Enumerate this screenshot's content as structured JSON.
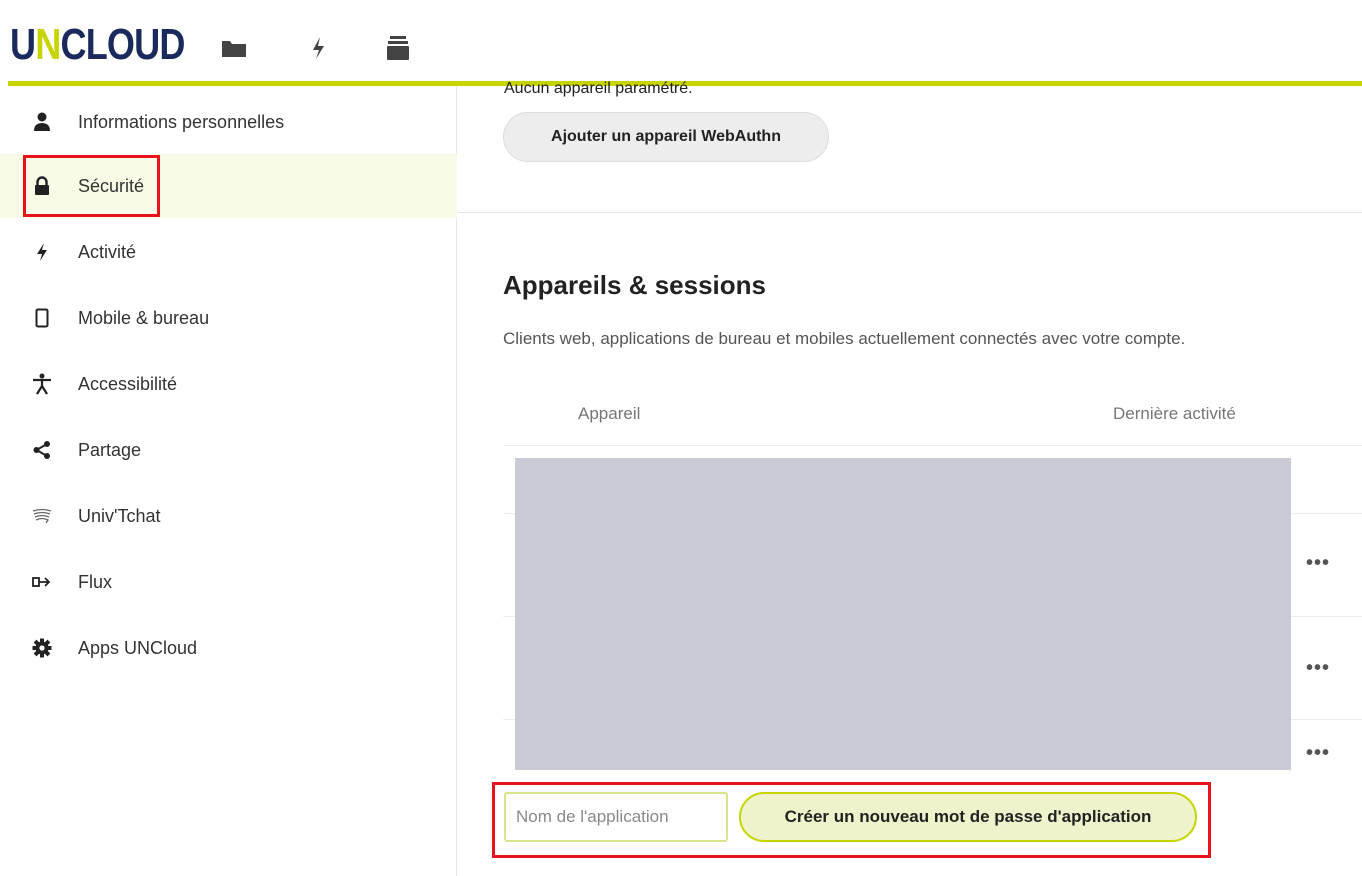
{
  "header": {
    "logo": {
      "pre": "U",
      "accent": "N",
      "post": "CLOUD"
    },
    "icons": [
      "folder-icon",
      "activity-icon",
      "archive-icon"
    ]
  },
  "sidebar": {
    "items": [
      {
        "label": "Informations personnelles",
        "icon": "user-icon"
      },
      {
        "label": "Sécurité",
        "icon": "lock-icon",
        "active": true
      },
      {
        "label": "Activité",
        "icon": "activity-icon"
      },
      {
        "label": "Mobile & bureau",
        "icon": "phone-icon"
      },
      {
        "label": "Accessibilité",
        "icon": "accessibility-icon"
      },
      {
        "label": "Partage",
        "icon": "share-icon"
      },
      {
        "label": "Univ'Tchat",
        "icon": "chat-icon"
      },
      {
        "label": "Flux",
        "icon": "flux-icon"
      },
      {
        "label": "Apps UNCloud",
        "icon": "gear-icon"
      }
    ]
  },
  "main": {
    "webauthn_status": "Aucun appareil paramétré.",
    "webauthn_button": "Ajouter un appareil WebAuthn",
    "sessions": {
      "title": "Appareils & sessions",
      "description": "Clients web, applications de bureau et mobiles actuellement connectés avec votre compte.",
      "col_device": "Appareil",
      "col_last_activity": "Dernière activité",
      "row_menu": "•••"
    },
    "app_password": {
      "placeholder": "Nom de l'application",
      "create_button": "Créer un nouveau mot de passe d'application"
    }
  },
  "colors": {
    "brand_navy": "#1b2a5c",
    "brand_lime": "#c7d400",
    "highlight_red": "#e8141c",
    "redacted": "#c8cad6"
  }
}
